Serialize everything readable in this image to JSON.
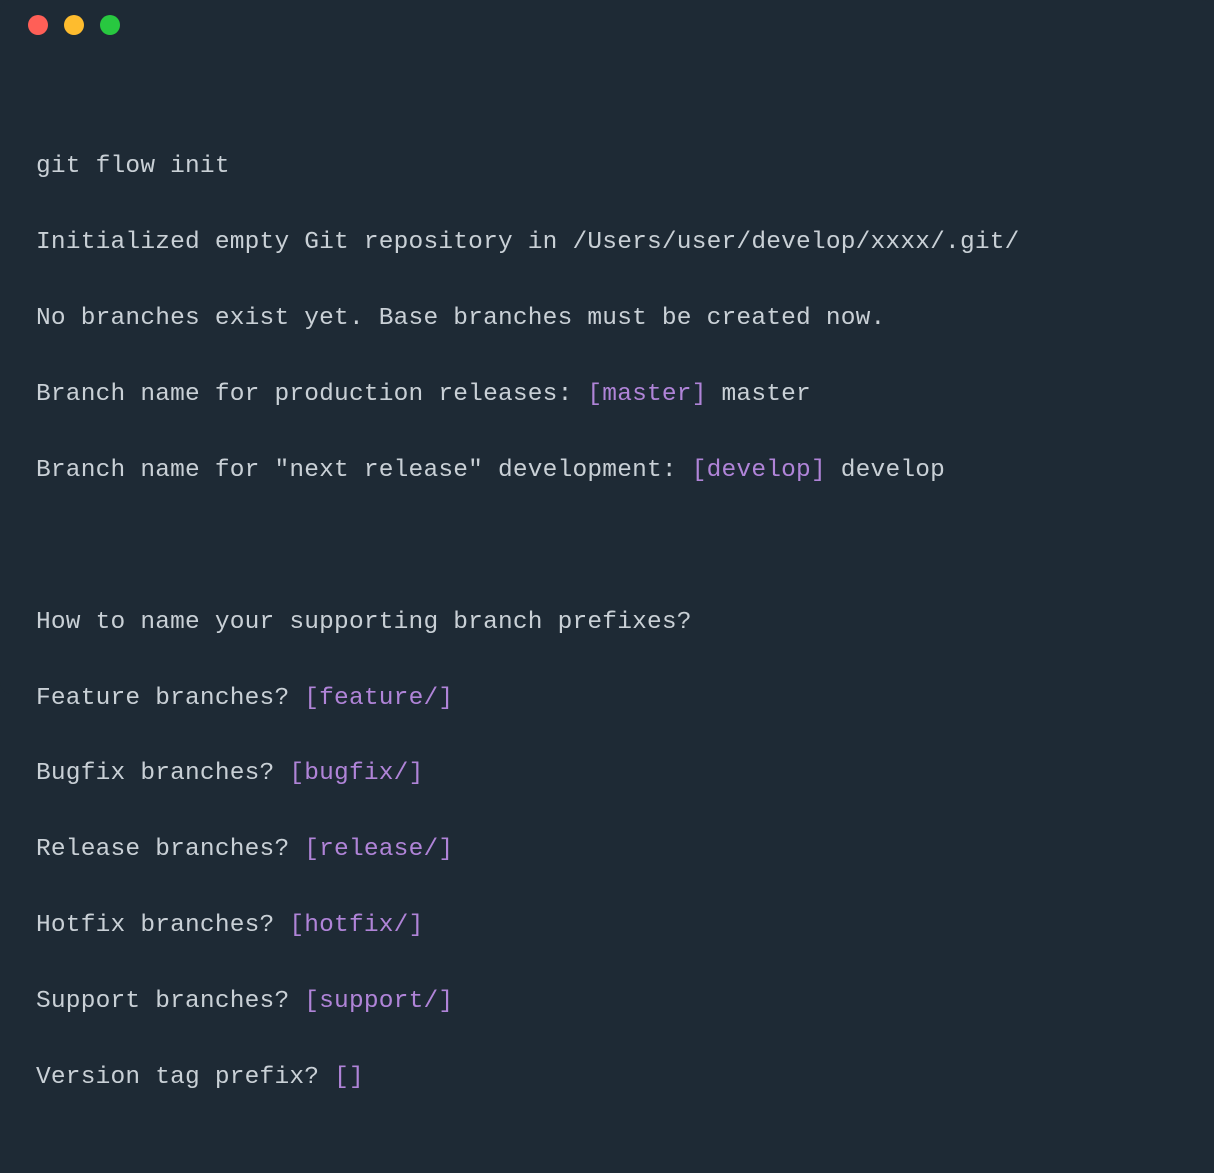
{
  "colors": {
    "bg": "#1e2a35",
    "text": "#c9d0d6",
    "accent": "#b084d8",
    "dot_red": "#ff5f57",
    "dot_yellow": "#febc2e",
    "dot_green": "#28c840"
  },
  "lines": {
    "l1": "git flow init",
    "l2": "Initialized empty Git repository in /Users/user/develop/xxxx/.git/",
    "l3": "No branches exist yet. Base branches must be created now.",
    "l4a": "Branch name for production releases: ",
    "l4b": "[master]",
    "l4c": " master",
    "l5a": "Branch name for \"next release\" development: ",
    "l5b": "[develop]",
    "l5c": " develop",
    "l6": "How to name your supporting branch prefixes?",
    "l7a": "Feature branches? ",
    "l7b": "[feature/]",
    "l8a": "Bugfix branches? ",
    "l8b": "[bugfix/]",
    "l9a": "Release branches? ",
    "l9b": "[release/]",
    "l10a": "Hotfix branches? ",
    "l10b": "[hotfix/]",
    "l11a": "Support branches? ",
    "l11b": "[support/]",
    "l12a": "Version tag prefix? ",
    "l12b": "[]"
  }
}
